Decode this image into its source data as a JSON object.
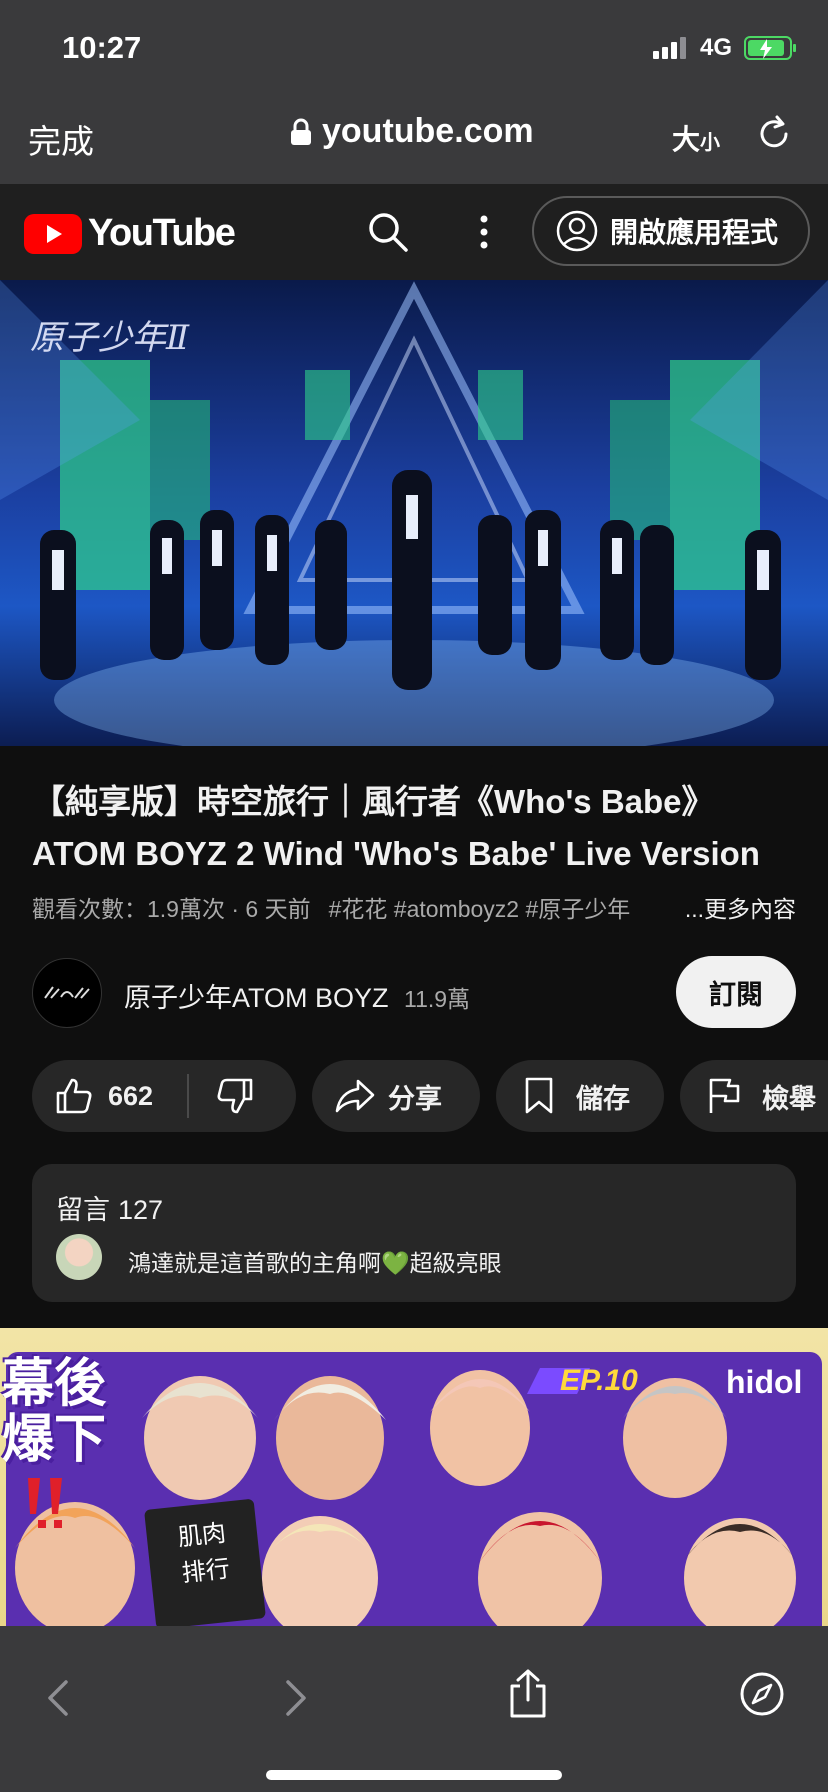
{
  "status_bar": {
    "time": "10:27",
    "network": "4G",
    "battery_color": "#4cd964"
  },
  "safari": {
    "done_label": "完成",
    "url": "youtube.com",
    "text_size_label_big": "大",
    "text_size_label_small": "小",
    "lock_icon": "lock-icon",
    "reload_icon": "reload-icon",
    "bottom_icons": [
      "back-icon",
      "forward-icon",
      "share-icon",
      "compass-icon"
    ]
  },
  "yt_header": {
    "logo_text": "YouTube",
    "open_app_label": "開啟應用程式",
    "brand_red": "#ff0000"
  },
  "video": {
    "overlay_logo": "原子少年Ⅱ",
    "title": "【純享版】時空旅行｜風行者《Who's Babe》ATOM BOYZ 2 Wind 'Who's Babe' Live Version",
    "views": "觀看次數：1.9萬次 · 6 天前",
    "hashtags": "#花花 #atomboyz2 #原子少年",
    "more_label": "...更多內容"
  },
  "channel": {
    "name": "原子少年ATOM BOYZ",
    "subscribers": "11.9萬",
    "subscribe_label": "訂閱"
  },
  "actions": {
    "likes": "662",
    "share_label": "分享",
    "save_label": "儲存",
    "report_label": "檢舉"
  },
  "comments": {
    "header": "留言",
    "count": "127",
    "top_comment": "鴻達就是這首歌的主角啊💚超級亮眼"
  },
  "next_video_thumb": {
    "left_title_line1": "幕後",
    "left_title_line2": "爆下",
    "episode": "EP.10",
    "brand": "hidol",
    "sign_line1": "肌肉",
    "sign_line2": "排行"
  }
}
